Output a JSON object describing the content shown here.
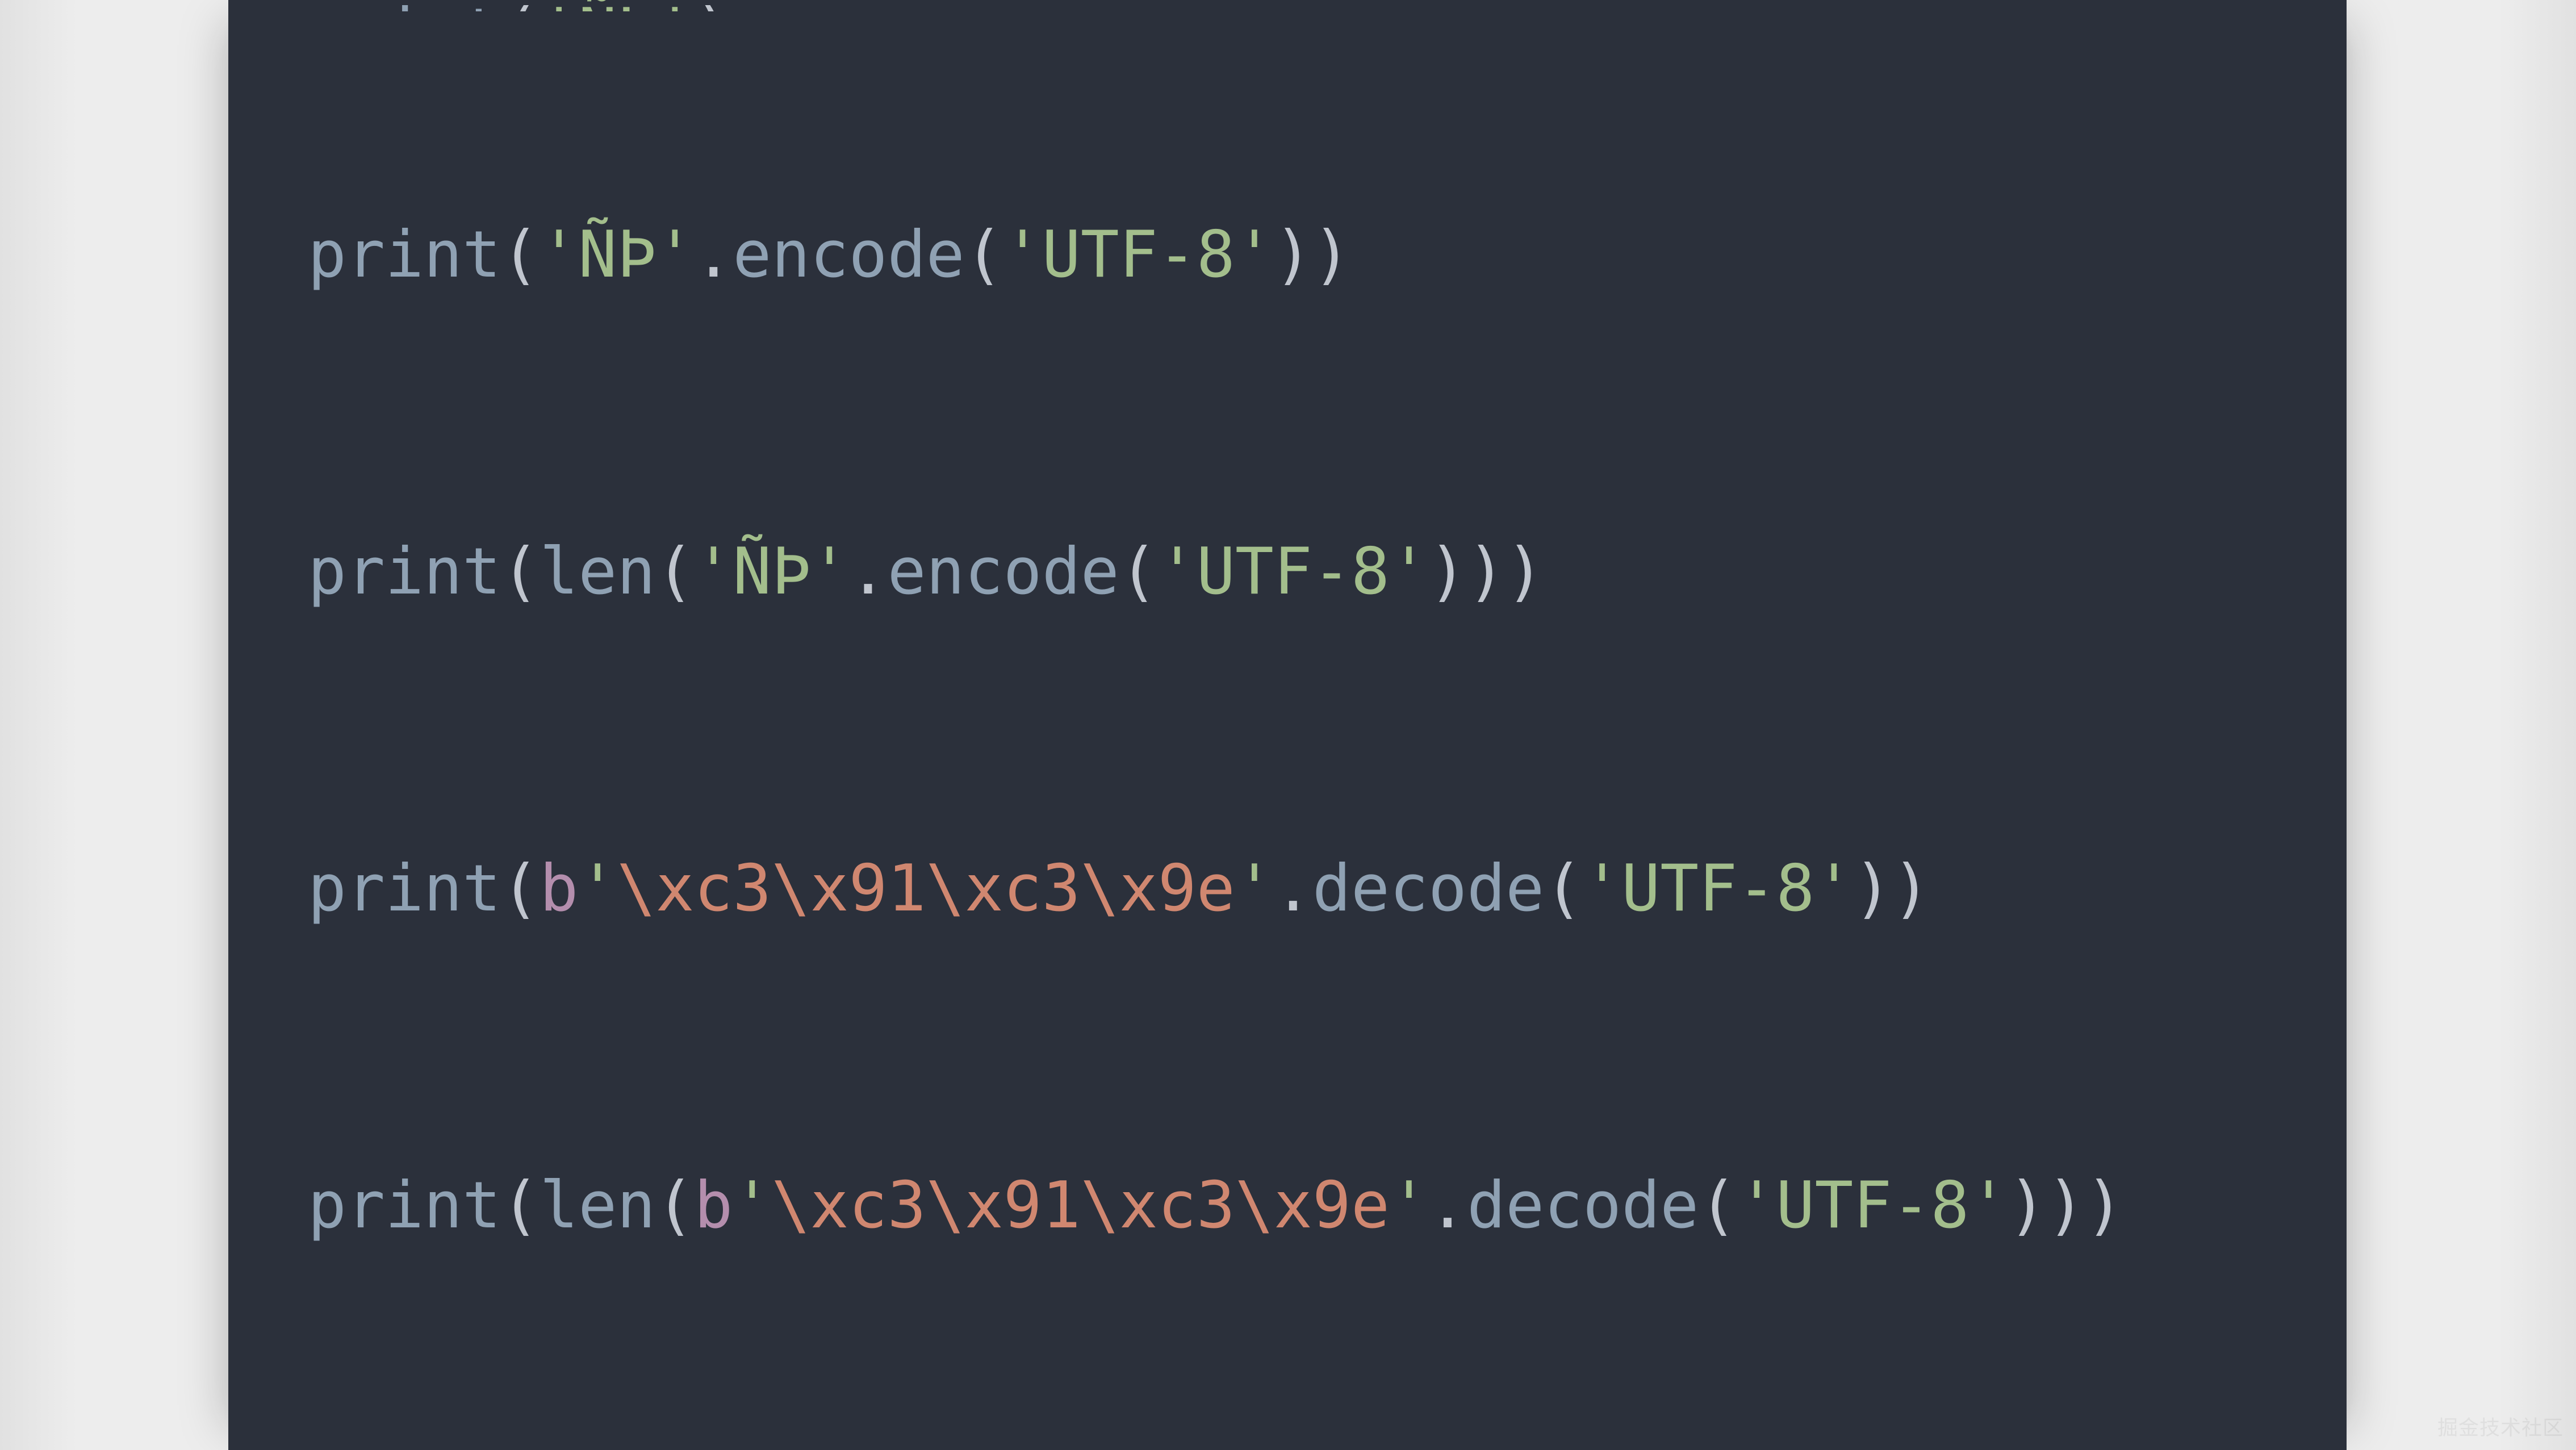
{
  "theme": {
    "background": "#2b303b",
    "foreground": "#c0c5ce",
    "function": "#8fa1b3",
    "builtin": "#8fa1b3",
    "string": "#a3be8c",
    "escape": "#d08770",
    "prefix": "#b48ead"
  },
  "code": {
    "line_cutoff_top": {
      "fn": "print",
      "lp": "(",
      "str": "'ÑÞ'",
      "rp": ")"
    },
    "line1": {
      "fn": "print",
      "lp": "(",
      "str": "'ÑÞ'",
      "dot": ".",
      "method": "encode",
      "lp2": "(",
      "arg": "'UTF-8'",
      "rp": "))"
    },
    "line2": {
      "fn": "print",
      "lp": "(",
      "builtin": "len",
      "lp2": "(",
      "str": "'ÑÞ'",
      "dot": ".",
      "method": "encode",
      "lp3": "(",
      "arg": "'UTF-8'",
      "rp": ")))"
    },
    "line3": {
      "fn": "print",
      "lp": "(",
      "bprefix": "b",
      "q1": "'",
      "esc": "\\xc3\\x91\\xc3\\x9e",
      "q2": "'",
      "dot": ".",
      "method": "decode",
      "lp2": "(",
      "arg": "'UTF-8'",
      "rp": "))"
    },
    "line4": {
      "fn": "print",
      "lp": "(",
      "builtin": "len",
      "lp2": "(",
      "bprefix": "b",
      "q1": "'",
      "esc": "\\xc3\\x91\\xc3\\x9e",
      "q2": "'",
      "dot": ".",
      "method": "decode",
      "lp3": "(",
      "arg": "'UTF-8'",
      "rp": ")))"
    }
  },
  "watermark": "掘金技术社区"
}
